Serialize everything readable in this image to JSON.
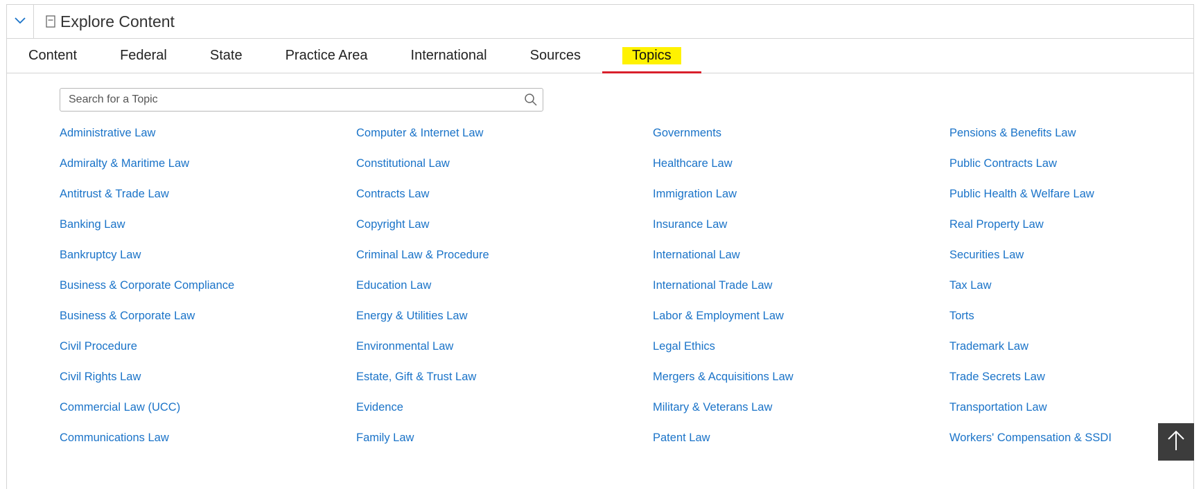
{
  "header": {
    "title": "Explore Content",
    "collapse_icon": "chevron-down-icon",
    "title_icon": "document-icon"
  },
  "tabs": [
    {
      "label": "Content",
      "active": false
    },
    {
      "label": "Federal",
      "active": false
    },
    {
      "label": "State",
      "active": false
    },
    {
      "label": "Practice Area",
      "active": false
    },
    {
      "label": "International",
      "active": false
    },
    {
      "label": "Sources",
      "active": false
    },
    {
      "label": "Topics",
      "active": true
    }
  ],
  "search": {
    "placeholder": "Search for a Topic",
    "value": "",
    "icon": "search-icon"
  },
  "topics": [
    [
      "Administrative Law",
      "Admiralty & Maritime Law",
      "Antitrust & Trade Law",
      "Banking Law",
      "Bankruptcy Law",
      "Business & Corporate Compliance",
      "Business & Corporate Law",
      "Civil Procedure",
      "Civil Rights Law",
      "Commercial Law (UCC)",
      "Communications Law"
    ],
    [
      "Computer & Internet Law",
      "Constitutional Law",
      "Contracts Law",
      "Copyright Law",
      "Criminal Law & Procedure",
      "Education Law",
      "Energy & Utilities Law",
      "Environmental Law",
      "Estate, Gift & Trust Law",
      "Evidence",
      "Family Law"
    ],
    [
      "Governments",
      "Healthcare Law",
      "Immigration Law",
      "Insurance Law",
      "International Law",
      "International Trade Law",
      "Labor & Employment Law",
      "Legal Ethics",
      "Mergers & Acquisitions Law",
      "Military & Veterans Law",
      "Patent Law"
    ],
    [
      "Pensions & Benefits Law",
      "Public Contracts Law",
      "Public Health & Welfare Law",
      "Real Property Law",
      "Securities Law",
      "Tax Law",
      "Torts",
      "Trademark Law",
      "Trade Secrets Law",
      "Transportation Law",
      "Workers' Compensation & SSDI"
    ]
  ],
  "back_to_top": {
    "icon": "arrow-up-icon"
  },
  "colors": {
    "link": "#1a73c8",
    "active_tab_highlight": "#fff200",
    "active_tab_underline": "#d9202c",
    "back_to_top_bg": "#3c3c3c"
  }
}
